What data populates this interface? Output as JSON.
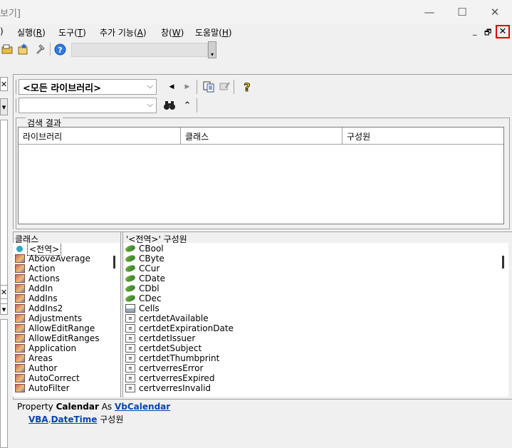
{
  "window": {
    "title": "보기]",
    "minimize": "—",
    "maximize": "☐",
    "close": "✕"
  },
  "menu": [
    {
      "label": ")",
      "key": "",
      "rest": ""
    },
    {
      "label": "실행(",
      "key": "R",
      "rest": ")"
    },
    {
      "label": "도구(",
      "key": "T",
      "rest": ")"
    },
    {
      "label": "추가 기능(",
      "key": "A",
      "rest": ")"
    },
    {
      "label": "창(",
      "key": "W",
      "rest": ")"
    },
    {
      "label": "도움말(",
      "key": "H",
      "rest": ")"
    }
  ],
  "mdi": {
    "minimize": "_",
    "restore": "🗗",
    "close": "✕"
  },
  "toolbar": {
    "icons": [
      "project-explorer-icon",
      "properties-icon",
      "toolbox-icon",
      "help-icon"
    ],
    "help_glyph": "?"
  },
  "object_browser": {
    "library_combo": "<모든 라이브러리>",
    "search_combo": "",
    "search_legend": "검색 결과",
    "columns": [
      "라이브러리",
      "클래스",
      "구성원"
    ],
    "classes_header": "클래스",
    "members_header": "'<전역>' 구성원",
    "classes": [
      {
        "name": "<전역>",
        "icon": "globe-icon"
      },
      {
        "name": "AboveAverage",
        "icon": "class-icon"
      },
      {
        "name": "Action",
        "icon": "class-icon"
      },
      {
        "name": "Actions",
        "icon": "class-icon"
      },
      {
        "name": "AddIn",
        "icon": "class-icon"
      },
      {
        "name": "AddIns",
        "icon": "class-icon"
      },
      {
        "name": "AddIns2",
        "icon": "class-icon"
      },
      {
        "name": "Adjustments",
        "icon": "class-icon"
      },
      {
        "name": "AllowEditRange",
        "icon": "class-icon"
      },
      {
        "name": "AllowEditRanges",
        "icon": "class-icon"
      },
      {
        "name": "Application",
        "icon": "class-icon"
      },
      {
        "name": "Areas",
        "icon": "class-icon"
      },
      {
        "name": "Author",
        "icon": "class-icon"
      },
      {
        "name": "AutoCorrect",
        "icon": "class-icon"
      },
      {
        "name": "AutoFilter",
        "icon": "class-icon"
      }
    ],
    "members": [
      {
        "name": "CBool",
        "icon": "function-icon"
      },
      {
        "name": "CByte",
        "icon": "function-icon"
      },
      {
        "name": "CCur",
        "icon": "function-icon"
      },
      {
        "name": "CDate",
        "icon": "function-icon"
      },
      {
        "name": "CDbl",
        "icon": "function-icon"
      },
      {
        "name": "CDec",
        "icon": "function-icon"
      },
      {
        "name": "Cells",
        "icon": "cells-property-icon"
      },
      {
        "name": "certdetAvailable",
        "icon": "constant-icon"
      },
      {
        "name": "certdetExpirationDate",
        "icon": "constant-icon"
      },
      {
        "name": "certdetIssuer",
        "icon": "constant-icon"
      },
      {
        "name": "certdetSubject",
        "icon": "constant-icon"
      },
      {
        "name": "certdetThumbprint",
        "icon": "constant-icon"
      },
      {
        "name": "certverresError",
        "icon": "constant-icon"
      },
      {
        "name": "certverresExpired",
        "icon": "constant-icon"
      },
      {
        "name": "certverresInvalid",
        "icon": "constant-icon"
      }
    ],
    "detail": {
      "line1_prefix": "Property ",
      "line1_name": "Calendar",
      "line1_as": " As ",
      "line1_type": "VbCalendar",
      "line2_lib": "VBA",
      "line2_dot": ".",
      "line2_class": "DateTime",
      "line2_suffix": " 구성원"
    }
  }
}
